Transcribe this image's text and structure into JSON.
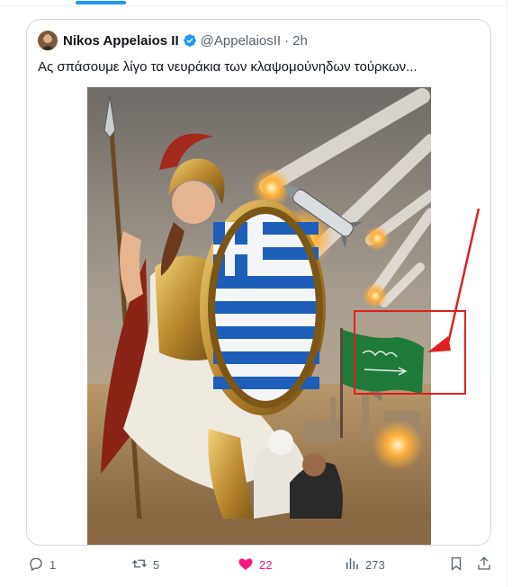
{
  "post": {
    "author_name": "Nikos Appelaios II",
    "handle": "@AppelaiosII",
    "separator": "·",
    "time": "2h",
    "text": "Ας σπάσουμε λίγο τα νευράκια των κλαψομούνηδων τούρκων...",
    "media_alt": "illustration-warrior-goddess-with-greek-shield"
  },
  "actions": {
    "replies": "1",
    "reposts": "5",
    "likes": "22",
    "views": "273"
  },
  "colors": {
    "accent": "#1d9bf0",
    "like": "#f91880",
    "muted": "#536471",
    "annotation": "#e02020"
  },
  "icons": {
    "reply": "reply-icon",
    "repost": "repost-icon",
    "like": "heart-icon",
    "views": "views-icon",
    "bookmark": "bookmark-icon",
    "share": "share-icon",
    "verified": "verified-badge-icon"
  }
}
